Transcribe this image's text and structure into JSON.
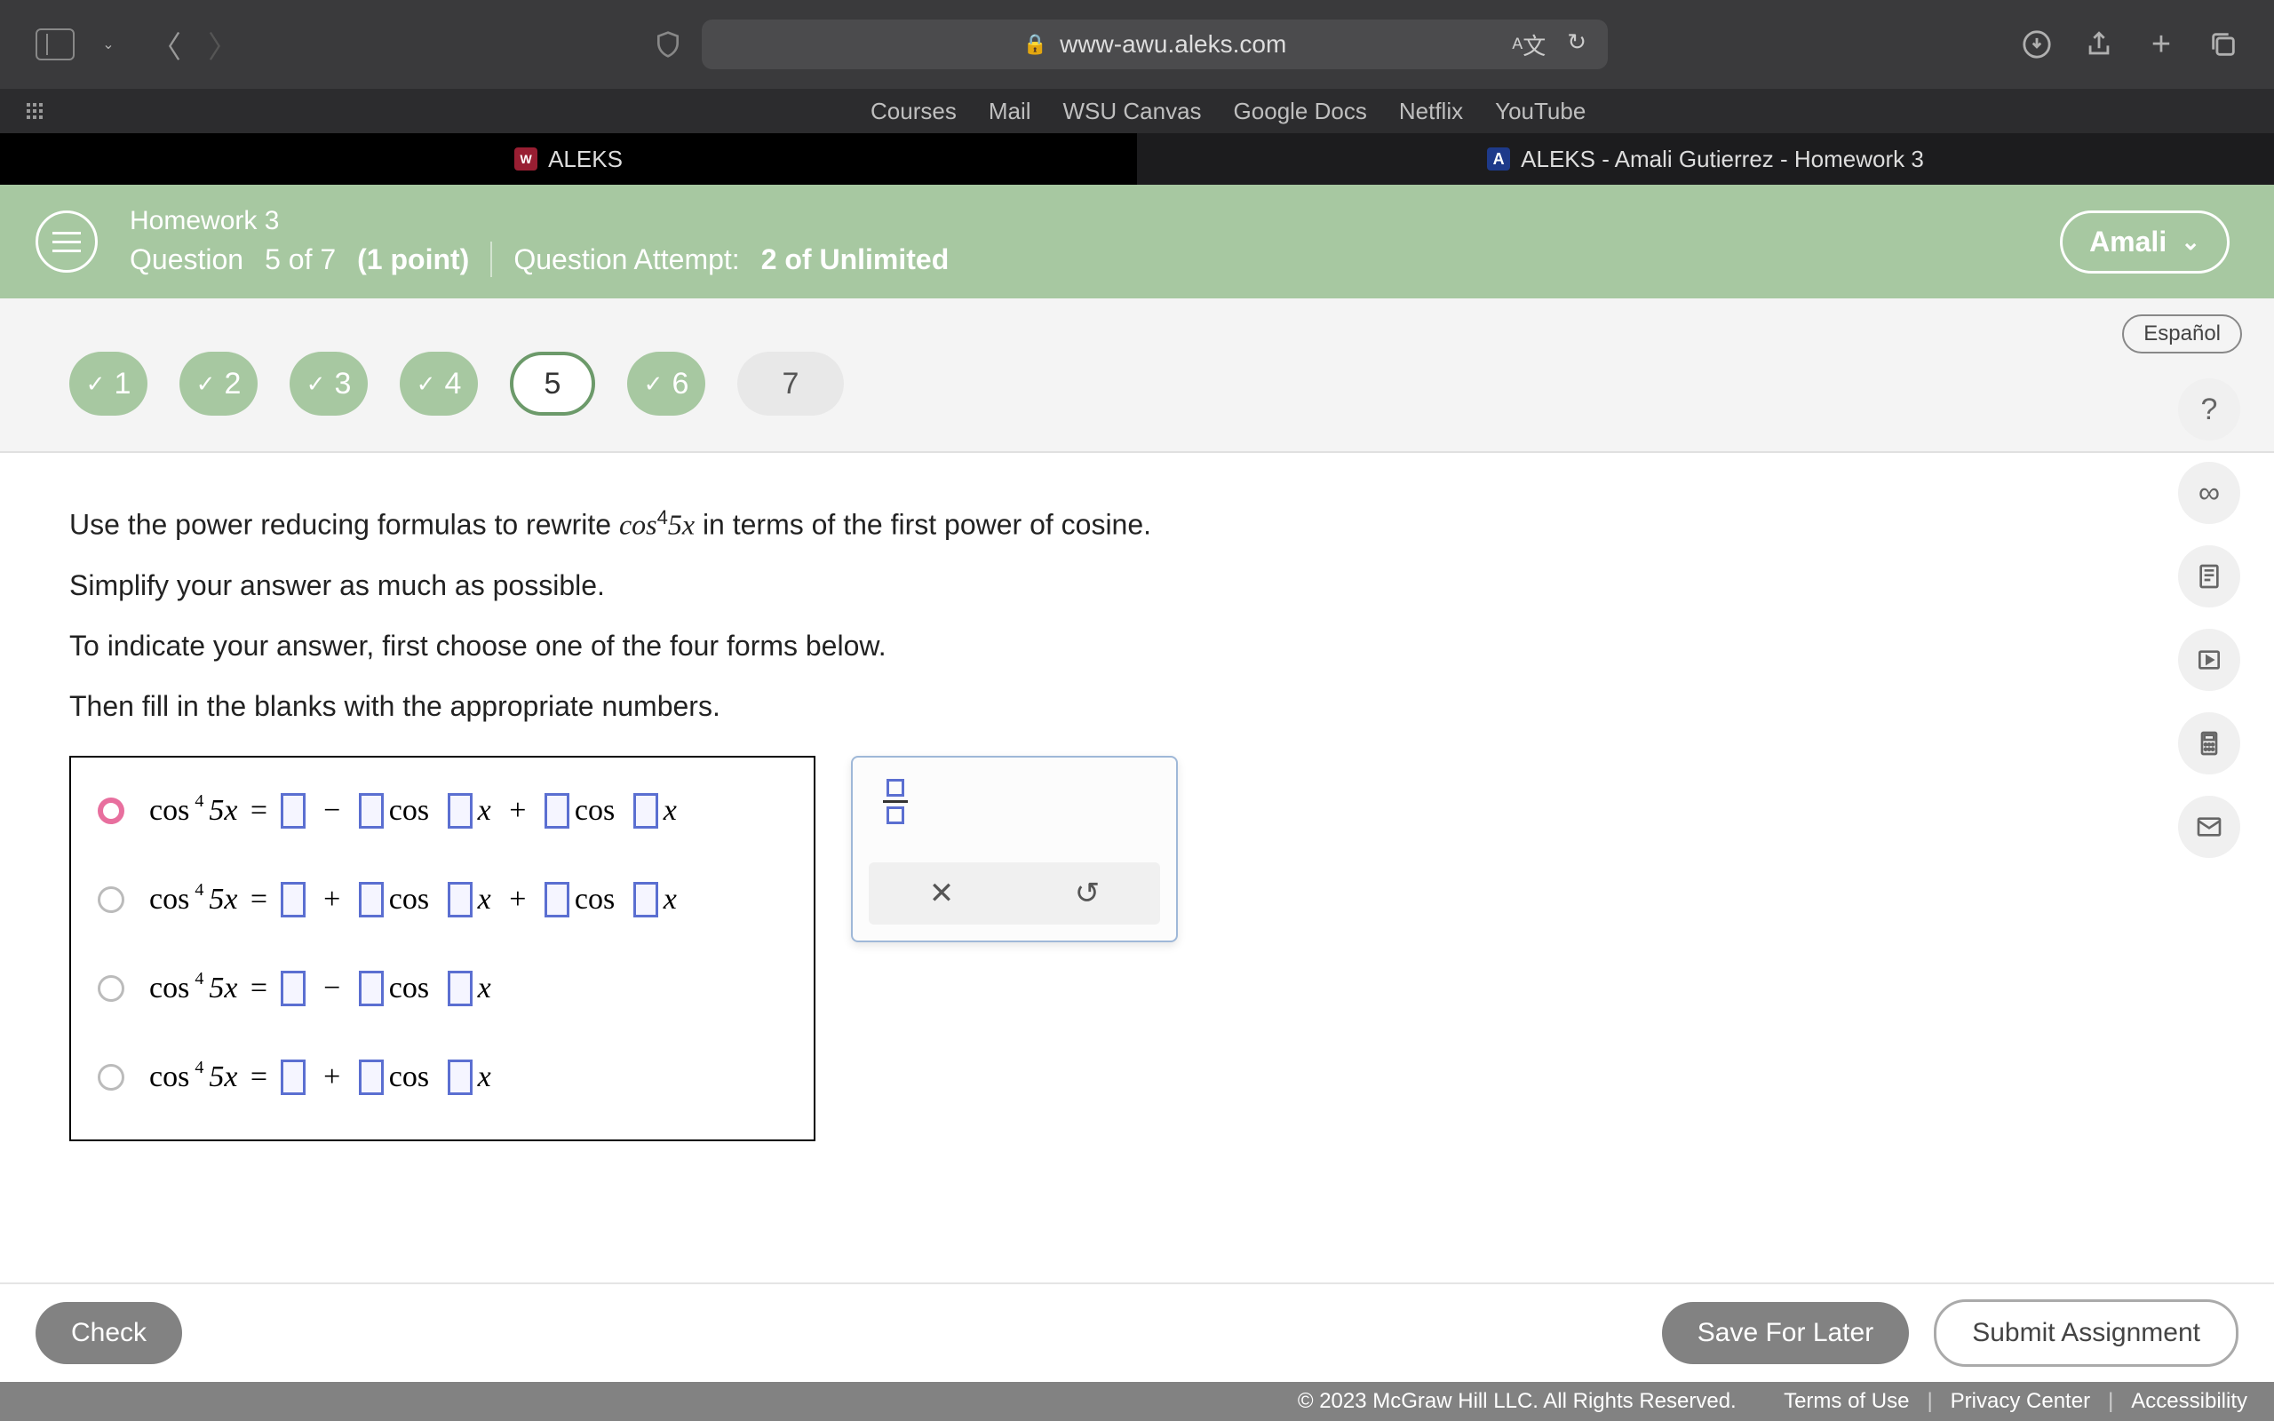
{
  "browser": {
    "url": "www-awu.aleks.com",
    "bookmarks": [
      "Courses",
      "Mail",
      "WSU Canvas",
      "Google Docs",
      "Netflix",
      "YouTube"
    ],
    "tabs": [
      {
        "label": "ALEKS"
      },
      {
        "label": "ALEKS - Amali Gutierrez - Homework 3"
      }
    ]
  },
  "header": {
    "hw_title": "Homework 3",
    "question_prefix": "Question",
    "question_num": "5 of 7",
    "points": "(1 point)",
    "attempt_prefix": "Question Attempt:",
    "attempt_val": "2 of Unlimited",
    "user": "Amali"
  },
  "lang_label": "Español",
  "questions": [
    {
      "n": "1",
      "state": "done"
    },
    {
      "n": "2",
      "state": "done"
    },
    {
      "n": "3",
      "state": "done"
    },
    {
      "n": "4",
      "state": "done"
    },
    {
      "n": "5",
      "state": "current"
    },
    {
      "n": "6",
      "state": "done"
    },
    {
      "n": "7",
      "state": "todo"
    }
  ],
  "problem": {
    "line1_a": "Use the power reducing formulas to rewrite ",
    "line1_expr": "cos⁴5x",
    "line1_b": " in terms of the first power of cosine.",
    "line2": "Simplify your answer as much as possible.",
    "line3": "To indicate your answer, first choose one of the four forms below.",
    "line4": "Then fill in the blanks with the appropriate numbers."
  },
  "options": [
    {
      "selected": true,
      "op1": "−",
      "op2": "+",
      "terms": 3
    },
    {
      "selected": false,
      "op1": "+",
      "op2": "+",
      "terms": 3
    },
    {
      "selected": false,
      "op1": "−",
      "terms": 2
    },
    {
      "selected": false,
      "op1": "+",
      "terms": 2
    }
  ],
  "buttons": {
    "check": "Check",
    "save": "Save For Later",
    "submit": "Submit Assignment"
  },
  "footer": {
    "copyright": "© 2023 McGraw Hill LLC. All Rights Reserved.",
    "terms": "Terms of Use",
    "privacy": "Privacy Center",
    "access": "Accessibility"
  }
}
